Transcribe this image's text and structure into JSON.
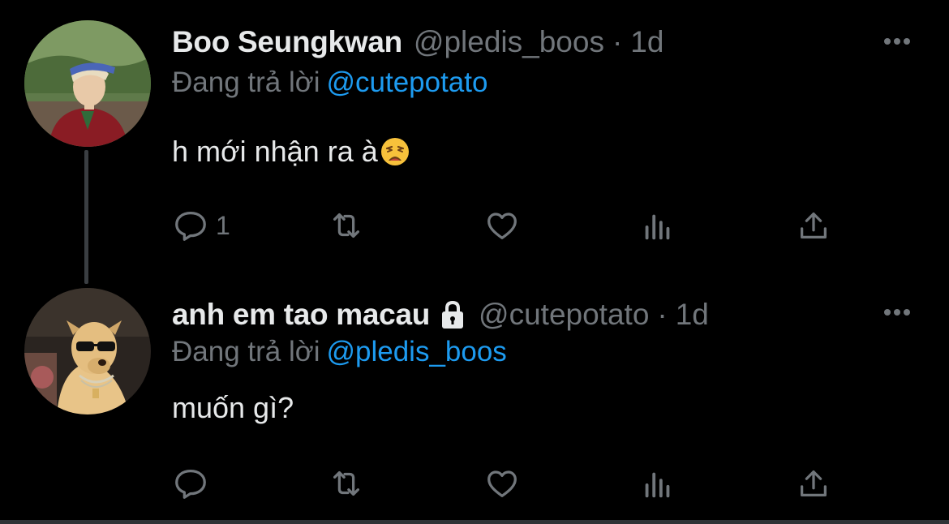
{
  "theme": {
    "background": "#000000",
    "text_primary": "#e7e9ea",
    "text_secondary": "#71767b",
    "accent": "#1d9bf0",
    "thread_line": "#3a3e42"
  },
  "tweets": [
    {
      "display_name": "Boo Seungkwan",
      "handle": "@pledis_boos",
      "separator": "·",
      "time": "1d",
      "replying_to_label": "Đang trả lời",
      "replying_to_handle": "@cutepotato",
      "text": "h mới nhận ra à",
      "emoji": "weary-face-emoji",
      "protected": false,
      "reply_count": "1",
      "avatar": "profile-photo-man-with-visor"
    },
    {
      "display_name": "anh em tao macau",
      "handle": "@cutepotato",
      "separator": "·",
      "time": "1d",
      "replying_to_label": "Đang trả lời",
      "replying_to_handle": "@pledis_boos",
      "text": "muốn gì?",
      "protected": true,
      "reply_count": "",
      "avatar": "profile-photo-dog-with-sunglasses"
    }
  ],
  "icons": {
    "more": "more-horizontal-icon",
    "reply": "reply-icon",
    "retweet": "retweet-icon",
    "like": "heart-icon",
    "views": "views-chart-icon",
    "share": "share-icon",
    "lock": "lock-icon"
  }
}
